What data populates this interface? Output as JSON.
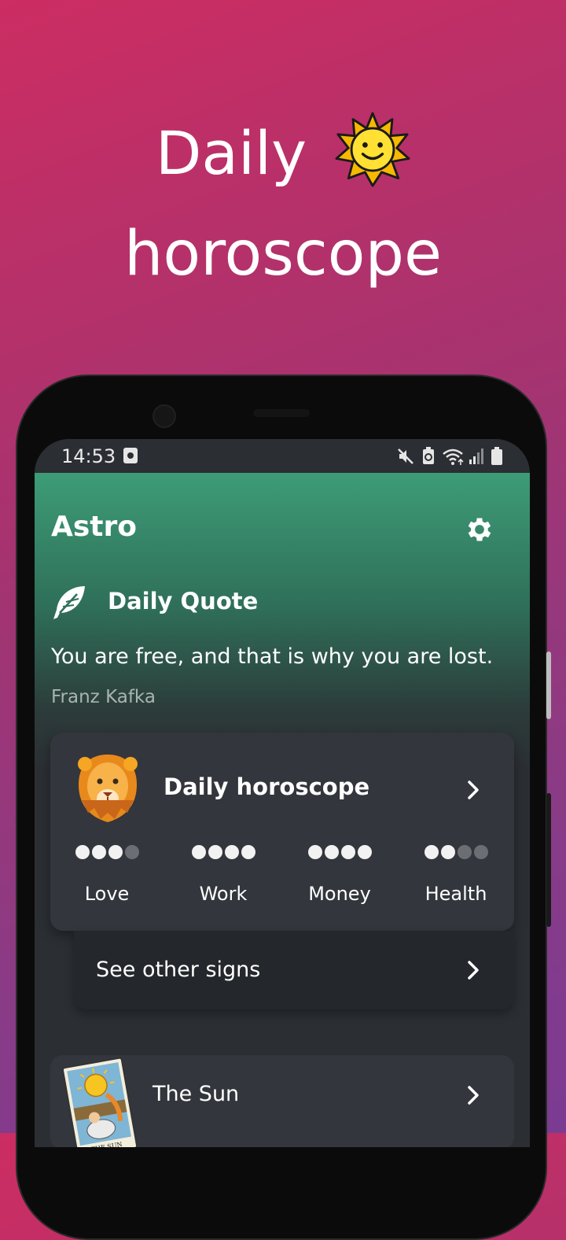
{
  "promo": {
    "headline_line1": "Daily",
    "headline_line2": "horoscope",
    "emoji": "sun-with-face"
  },
  "statusbar": {
    "time": "14:53",
    "icons": [
      "screenshot-icon",
      "mute-icon",
      "battery-saver-icon",
      "wifi-icon",
      "signal-icon",
      "battery-icon"
    ]
  },
  "app": {
    "title": "Astro",
    "settings_icon": "gear-icon",
    "quote": {
      "heading": "Daily Quote",
      "text": "You are free, and that is why you are lost.",
      "author": "Franz Kafka"
    },
    "horoscope_card": {
      "title": "Daily horoscope",
      "sign_icon": "leo-lion-icon",
      "ratings": [
        {
          "label": "Love",
          "value": 3,
          "max": 4
        },
        {
          "label": "Work",
          "value": 4,
          "max": 4
        },
        {
          "label": "Money",
          "value": 4,
          "max": 4
        },
        {
          "label": "Health",
          "value": 2,
          "max": 4
        }
      ]
    },
    "other_signs": {
      "label": "See other signs"
    },
    "tarot": {
      "label": "The Sun",
      "card_caption": "THE SUN"
    }
  },
  "colors": {
    "accent_green": "#3d9c77",
    "card_bg": "#33363c",
    "bg_gradient_start": "#cc2d62",
    "bg_gradient_end": "#7b3b93"
  }
}
